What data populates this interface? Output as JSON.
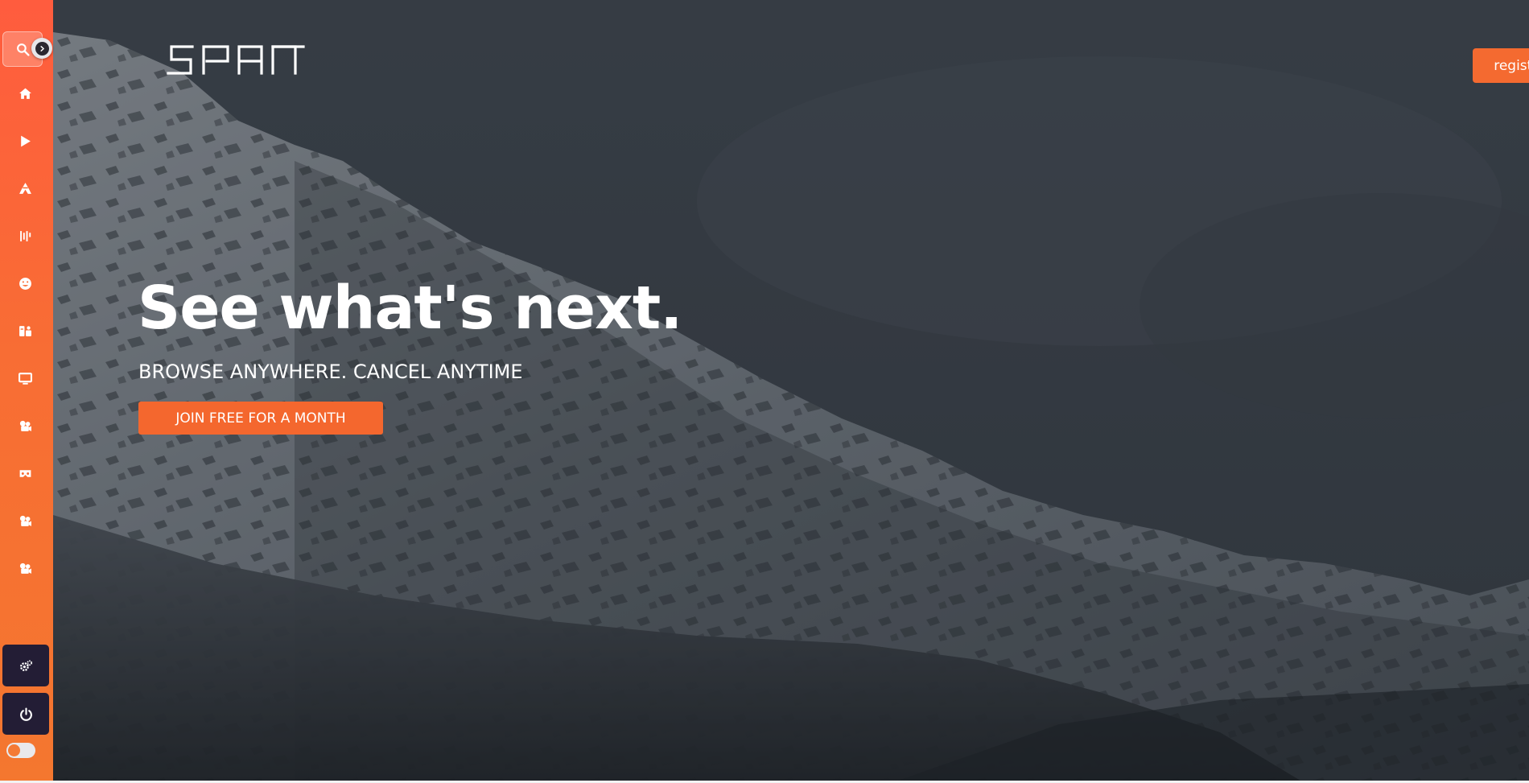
{
  "brand": {
    "logo_text": "SPAN",
    "accent_color": "#f46a30",
    "sidebar_color": "#ff5c3e",
    "dark_button_color": "#231d35"
  },
  "header": {
    "register_label": "register"
  },
  "hero": {
    "headline": "See what's next.",
    "subheadline": "BROWSE ANYWHERE. CANCEL ANYTIME",
    "cta_label": "JOIN FREE FOR A MONTH"
  },
  "sidebar": {
    "items": [
      {
        "icon": "search-icon",
        "active": true
      },
      {
        "icon": "home-icon"
      },
      {
        "icon": "play-icon"
      },
      {
        "icon": "anime-icon"
      },
      {
        "icon": "music-icon"
      },
      {
        "icon": "smile-icon"
      },
      {
        "icon": "kids-icon"
      },
      {
        "icon": "desktop-icon"
      },
      {
        "icon": "film-reel-icon"
      },
      {
        "icon": "vr-headset-icon"
      },
      {
        "icon": "film-reel-icon"
      },
      {
        "icon": "film-reel-icon"
      }
    ],
    "bottom_buttons": [
      {
        "icon": "settings-icon"
      },
      {
        "icon": "power-icon"
      }
    ],
    "collapse_toggle_icon": "chevron-right-icon",
    "theme_switch_icon": "theme-toggle"
  }
}
